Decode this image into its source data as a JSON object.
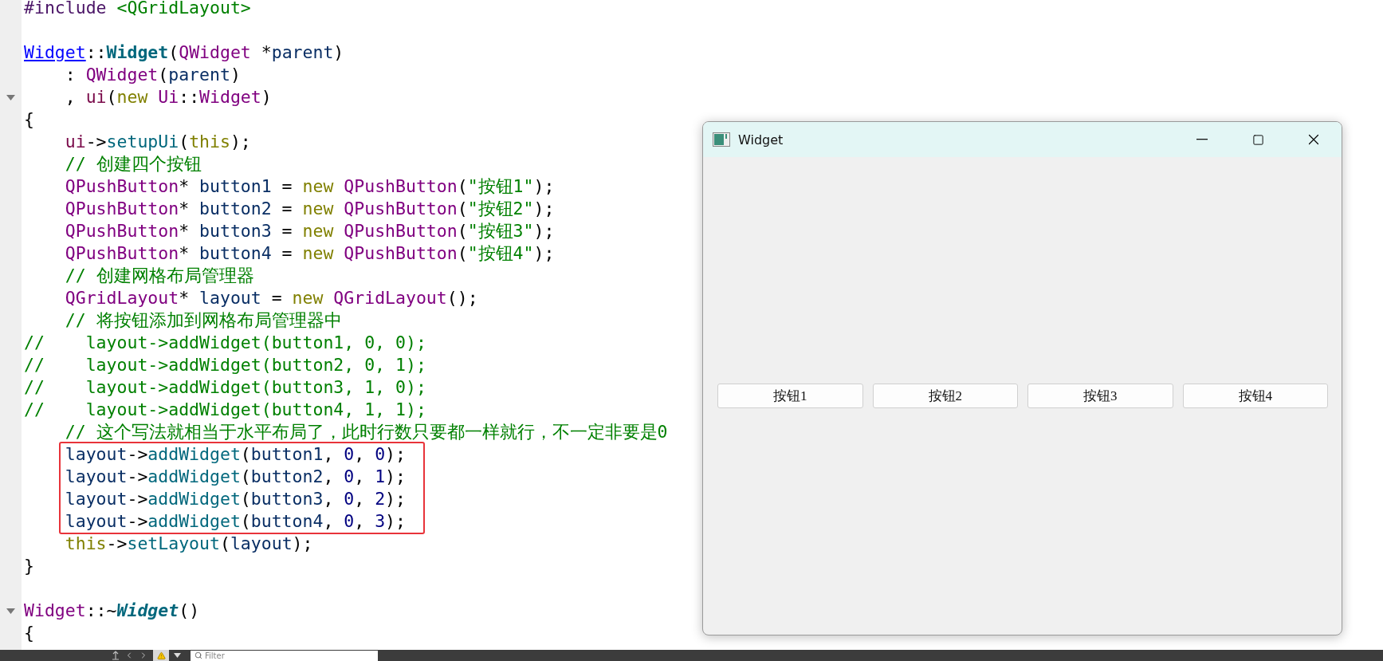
{
  "editor": {
    "lines": [
      {
        "kind": "line",
        "fold": false,
        "segments": [
          {
            "text": "#include",
            "kind": "pp"
          },
          {
            "text": " <QGridLayout>",
            "kind": "s"
          }
        ]
      },
      {
        "kind": "line",
        "fold": false
      },
      {
        "kind": "line",
        "fold": false,
        "segments": [
          {
            "text": "Widget",
            "kind": "l"
          },
          {
            "text": "::",
            "kind": "p"
          },
          {
            "text": "Widget",
            "kind": "d"
          },
          {
            "text": "(",
            "kind": "p"
          },
          {
            "text": "QWidget",
            "kind": "t"
          },
          {
            "text": " *",
            "kind": "p"
          },
          {
            "text": "parent",
            "kind": "v"
          },
          {
            "text": ")",
            "kind": "p"
          }
        ]
      },
      {
        "kind": "line",
        "fold": false,
        "segments": [
          {
            "text": "    : ",
            "kind": "p"
          },
          {
            "text": "QWidget",
            "kind": "t"
          },
          {
            "text": "(",
            "kind": "p"
          },
          {
            "text": "parent",
            "kind": "v"
          },
          {
            "text": ")",
            "kind": "p"
          }
        ]
      },
      {
        "kind": "line",
        "fold": true,
        "segments": [
          {
            "text": "    , ",
            "kind": "p"
          },
          {
            "text": "ui",
            "kind": "m"
          },
          {
            "text": "(",
            "kind": "p"
          },
          {
            "text": "new ",
            "kind": "k"
          },
          {
            "text": "Ui",
            "kind": "t"
          },
          {
            "text": "::",
            "kind": "p"
          },
          {
            "text": "Widget",
            "kind": "t"
          },
          {
            "text": ")",
            "kind": "p"
          }
        ]
      },
      {
        "kind": "line",
        "fold": false,
        "segments": [
          {
            "text": "{",
            "kind": "p"
          }
        ]
      },
      {
        "kind": "line",
        "fold": false,
        "segments": [
          {
            "text": "    ui",
            "kind": "m"
          },
          {
            "text": "->",
            "kind": "p"
          },
          {
            "text": "setupUi",
            "kind": "f"
          },
          {
            "text": "(",
            "kind": "p"
          },
          {
            "text": "this",
            "kind": "k"
          },
          {
            "text": ");",
            "kind": "p"
          }
        ]
      },
      {
        "kind": "line",
        "fold": false,
        "segments": [
          {
            "text": "    // 创建四个按钮",
            "kind": "c"
          }
        ]
      },
      {
        "kind": "line",
        "fold": false,
        "segments": [
          {
            "text": "    QPushButton",
            "kind": "t"
          },
          {
            "text": "* ",
            "kind": "p"
          },
          {
            "text": "button1",
            "kind": "v"
          },
          {
            "text": " = ",
            "kind": "p"
          },
          {
            "text": "new ",
            "kind": "k"
          },
          {
            "text": "QPushButton",
            "kind": "t"
          },
          {
            "text": "(",
            "kind": "p"
          },
          {
            "text": "\"按钮1\"",
            "kind": "s"
          },
          {
            "text": ");",
            "kind": "p"
          }
        ]
      },
      {
        "kind": "line",
        "fold": false,
        "segments": [
          {
            "text": "    QPushButton",
            "kind": "t"
          },
          {
            "text": "* ",
            "kind": "p"
          },
          {
            "text": "button2",
            "kind": "v"
          },
          {
            "text": " = ",
            "kind": "p"
          },
          {
            "text": "new ",
            "kind": "k"
          },
          {
            "text": "QPushButton",
            "kind": "t"
          },
          {
            "text": "(",
            "kind": "p"
          },
          {
            "text": "\"按钮2\"",
            "kind": "s"
          },
          {
            "text": ");",
            "kind": "p"
          }
        ]
      },
      {
        "kind": "line",
        "fold": false,
        "segments": [
          {
            "text": "    QPushButton",
            "kind": "t"
          },
          {
            "text": "* ",
            "kind": "p"
          },
          {
            "text": "button3",
            "kind": "v"
          },
          {
            "text": " = ",
            "kind": "p"
          },
          {
            "text": "new ",
            "kind": "k"
          },
          {
            "text": "QPushButton",
            "kind": "t"
          },
          {
            "text": "(",
            "kind": "p"
          },
          {
            "text": "\"按钮3\"",
            "kind": "s"
          },
          {
            "text": ");",
            "kind": "p"
          }
        ]
      },
      {
        "kind": "line",
        "fold": false,
        "segments": [
          {
            "text": "    QPushButton",
            "kind": "t"
          },
          {
            "text": "* ",
            "kind": "p"
          },
          {
            "text": "button4",
            "kind": "v"
          },
          {
            "text": " = ",
            "kind": "p"
          },
          {
            "text": "new ",
            "kind": "k"
          },
          {
            "text": "QPushButton",
            "kind": "t"
          },
          {
            "text": "(",
            "kind": "p"
          },
          {
            "text": "\"按钮4\"",
            "kind": "s"
          },
          {
            "text": ");",
            "kind": "p"
          }
        ]
      },
      {
        "kind": "line",
        "fold": false,
        "segments": [
          {
            "text": "    // 创建网格布局管理器",
            "kind": "c"
          }
        ]
      },
      {
        "kind": "line",
        "fold": false,
        "segments": [
          {
            "text": "    QGridLayout",
            "kind": "t"
          },
          {
            "text": "* ",
            "kind": "p"
          },
          {
            "text": "layout",
            "kind": "v"
          },
          {
            "text": " = ",
            "kind": "p"
          },
          {
            "text": "new ",
            "kind": "k"
          },
          {
            "text": "QGridLayout",
            "kind": "t"
          },
          {
            "text": "();",
            "kind": "p"
          }
        ]
      },
      {
        "kind": "line",
        "fold": false,
        "segments": [
          {
            "text": "    // 将按钮添加到网格布局管理器中",
            "kind": "c"
          }
        ]
      },
      {
        "kind": "line",
        "fold": false,
        "segments": [
          {
            "text": "//    layout->addWidget(button1, 0, 0);",
            "kind": "c"
          }
        ]
      },
      {
        "kind": "line",
        "fold": false,
        "segments": [
          {
            "text": "//    layout->addWidget(button2, 0, 1);",
            "kind": "c"
          }
        ]
      },
      {
        "kind": "line",
        "fold": false,
        "segments": [
          {
            "text": "//    layout->addWidget(button3, 1, 0);",
            "kind": "c"
          }
        ]
      },
      {
        "kind": "line",
        "fold": false,
        "segments": [
          {
            "text": "//    layout->addWidget(button4, 1, 1);",
            "kind": "c"
          }
        ]
      },
      {
        "kind": "line",
        "fold": false,
        "segments": [
          {
            "text": "    // 这个写法就相当于水平布局了，此时行数只要都一样就行，不一定非要是0",
            "kind": "c"
          }
        ]
      },
      {
        "kind": "highlight",
        "lines": [
          {
            "segments": [
              {
                "text": "layout",
                "kind": "v"
              },
              {
                "text": "->",
                "kind": "p"
              },
              {
                "text": "addWidget",
                "kind": "f"
              },
              {
                "text": "(",
                "kind": "p"
              },
              {
                "text": "button1",
                "kind": "v"
              },
              {
                "text": ", ",
                "kind": "p"
              },
              {
                "text": "0",
                "kind": "n"
              },
              {
                "text": ", ",
                "kind": "p"
              },
              {
                "text": "0",
                "kind": "n"
              },
              {
                "text": ");",
                "kind": "p"
              }
            ]
          },
          {
            "segments": [
              {
                "text": "layout",
                "kind": "v"
              },
              {
                "text": "->",
                "kind": "p"
              },
              {
                "text": "addWidget",
                "kind": "f"
              },
              {
                "text": "(",
                "kind": "p"
              },
              {
                "text": "button2",
                "kind": "v"
              },
              {
                "text": ", ",
                "kind": "p"
              },
              {
                "text": "0",
                "kind": "n"
              },
              {
                "text": ", ",
                "kind": "p"
              },
              {
                "text": "1",
                "kind": "n"
              },
              {
                "text": ");",
                "kind": "p"
              }
            ]
          },
          {
            "segments": [
              {
                "text": "layout",
                "kind": "v"
              },
              {
                "text": "->",
                "kind": "p"
              },
              {
                "text": "addWidget",
                "kind": "f"
              },
              {
                "text": "(",
                "kind": "p"
              },
              {
                "text": "button3",
                "kind": "v"
              },
              {
                "text": ", ",
                "kind": "p"
              },
              {
                "text": "0",
                "kind": "n"
              },
              {
                "text": ", ",
                "kind": "p"
              },
              {
                "text": "2",
                "kind": "n"
              },
              {
                "text": ");",
                "kind": "p"
              }
            ]
          },
          {
            "segments": [
              {
                "text": "layout",
                "kind": "v"
              },
              {
                "text": "->",
                "kind": "p"
              },
              {
                "text": "addWidget",
                "kind": "f"
              },
              {
                "text": "(",
                "kind": "p"
              },
              {
                "text": "button4",
                "kind": "v"
              },
              {
                "text": ", ",
                "kind": "p"
              },
              {
                "text": "0",
                "kind": "n"
              },
              {
                "text": ", ",
                "kind": "p"
              },
              {
                "text": "3",
                "kind": "n"
              },
              {
                "text": ");",
                "kind": "p"
              }
            ]
          }
        ]
      },
      {
        "kind": "line",
        "fold": false,
        "segments": [
          {
            "text": "    this",
            "kind": "k"
          },
          {
            "text": "->",
            "kind": "p"
          },
          {
            "text": "setLayout",
            "kind": "f"
          },
          {
            "text": "(",
            "kind": "p"
          },
          {
            "text": "layout",
            "kind": "v"
          },
          {
            "text": ");",
            "kind": "p"
          }
        ]
      },
      {
        "kind": "line",
        "fold": false,
        "segments": [
          {
            "text": "}",
            "kind": "p"
          }
        ]
      },
      {
        "kind": "line",
        "fold": false
      },
      {
        "kind": "line",
        "fold": true,
        "segments": [
          {
            "text": "Widget",
            "kind": "t"
          },
          {
            "text": "::~",
            "kind": "p"
          },
          {
            "text": "Widget",
            "kind": "di"
          },
          {
            "text": "()",
            "kind": "p"
          }
        ]
      },
      {
        "kind": "line",
        "fold": false,
        "segments": [
          {
            "text": "{",
            "kind": "p"
          }
        ]
      }
    ]
  },
  "preview_window": {
    "title": "Widget",
    "buttons": [
      {
        "label": "按钮1"
      },
      {
        "label": "按钮2"
      },
      {
        "label": "按钮3"
      },
      {
        "label": "按钮4"
      }
    ]
  },
  "bottom_bar": {
    "filter": {
      "placeholder": "Filter"
    }
  }
}
